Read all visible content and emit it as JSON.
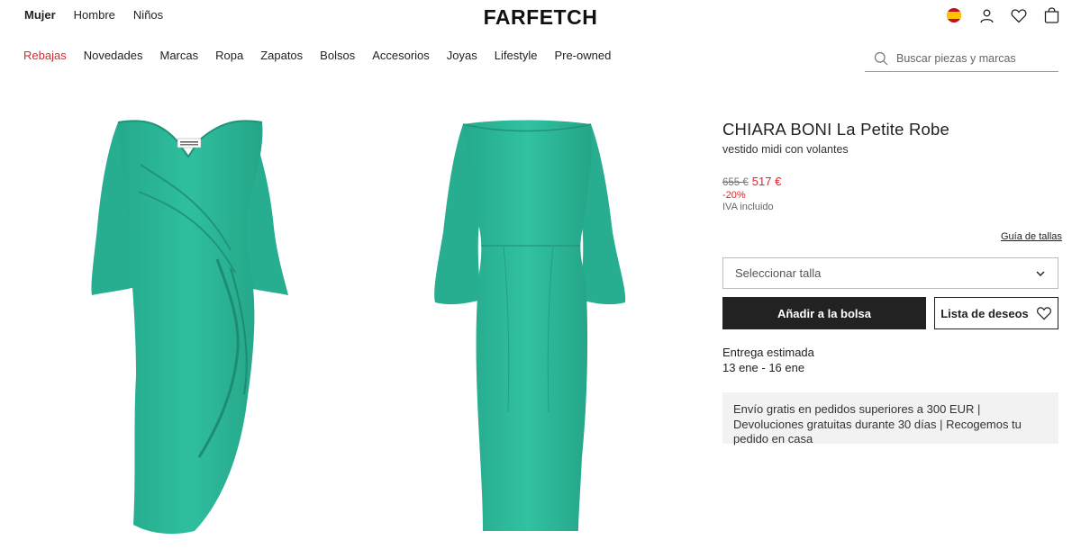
{
  "gender_nav": [
    {
      "label": "Mujer",
      "active": true
    },
    {
      "label": "Hombre",
      "active": false
    },
    {
      "label": "Niños",
      "active": false
    }
  ],
  "logo": "FARFETCH",
  "header_icons": [
    "spain-flag-icon",
    "account-icon",
    "wishlist-heart-icon",
    "shopping-bag-icon"
  ],
  "category_nav": [
    {
      "label": "Rebajas",
      "highlight": true
    },
    {
      "label": "Novedades"
    },
    {
      "label": "Marcas"
    },
    {
      "label": "Ropa"
    },
    {
      "label": "Zapatos"
    },
    {
      "label": "Bolsos"
    },
    {
      "label": "Accesorios"
    },
    {
      "label": "Joyas"
    },
    {
      "label": "Lifestyle"
    },
    {
      "label": "Pre-owned"
    }
  ],
  "search": {
    "placeholder": "Buscar piezas y marcas"
  },
  "product": {
    "brand": "CHIARA BONI La Petite Robe",
    "name": "vestido midi con volantes",
    "old_price": "655 €",
    "new_price": "517 €",
    "discount": "-20%",
    "vat": "IVA incluido",
    "images": [
      "dress-front-image",
      "dress-back-image"
    ],
    "dress_color": "#2cb99a"
  },
  "size_guide": "Guía de tallas",
  "size_select": {
    "placeholder": "Seleccionar talla"
  },
  "buttons": {
    "add_to_bag": "Añadir a la bolsa",
    "wishlist": "Lista de deseos"
  },
  "delivery": {
    "label": "Entrega estimada",
    "dates": "13 ene - 16 ene"
  },
  "shipping_note": "Envío gratis en pedidos superiores a 300 EUR | Devoluciones gratuitas durante 30 días | Recogemos tu pedido en casa",
  "colors": {
    "sale_red": "#d9272e",
    "button_black": "#222222",
    "info_bg": "#f2f2f2"
  }
}
